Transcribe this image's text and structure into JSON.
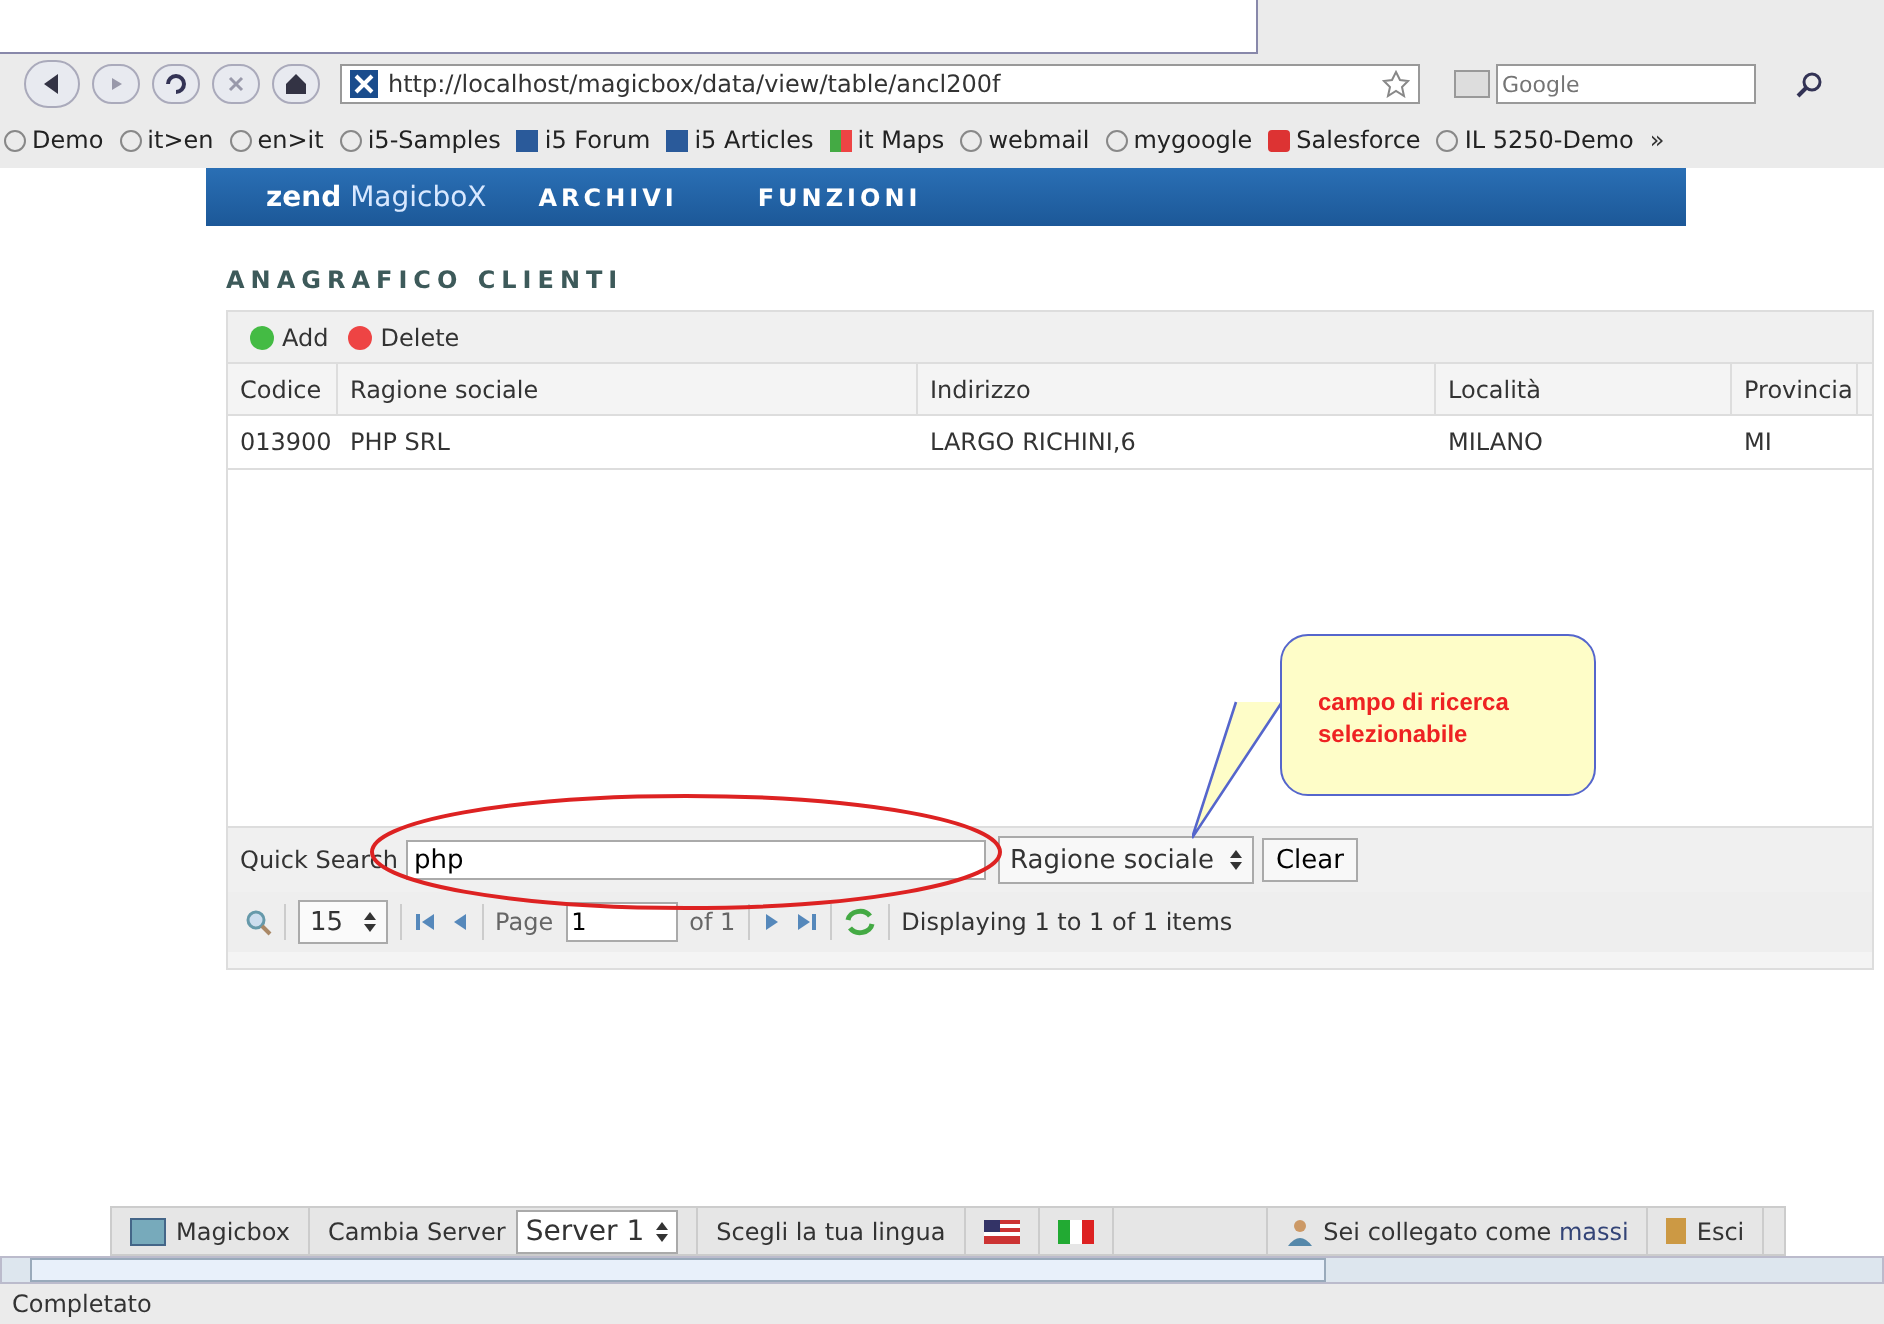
{
  "browser": {
    "url": "http://localhost/magicbox/data/view/table/ancl200f",
    "search_placeholder": "Google",
    "bookmarks": [
      {
        "label": "Demo",
        "kind": "globe"
      },
      {
        "label": "it>en",
        "kind": "globe"
      },
      {
        "label": "en>it",
        "kind": "globe"
      },
      {
        "label": "i5-Samples",
        "kind": "globe"
      },
      {
        "label": "i5 Forum",
        "kind": "zend"
      },
      {
        "label": "i5 Articles",
        "kind": "zend"
      },
      {
        "label": "it Maps",
        "kind": "maps"
      },
      {
        "label": "webmail",
        "kind": "globe"
      },
      {
        "label": "mygoogle",
        "kind": "globe"
      },
      {
        "label": "Salesforce",
        "kind": "sales"
      },
      {
        "label": "IL 5250-Demo",
        "kind": "globe"
      }
    ],
    "more": "»"
  },
  "app": {
    "logo_prefix": "zend",
    "logo_name": "MagicboX",
    "menu": [
      "ARCHIVI",
      "FUNZIONI"
    ]
  },
  "page_title": "ANAGRAFICO CLIENTI",
  "grid": {
    "toolbar": [
      {
        "label": "Add",
        "kind": "add"
      },
      {
        "label": "Delete",
        "kind": "delete"
      }
    ],
    "columns": [
      "Codice",
      "Ragione sociale",
      "Indirizzo",
      "Località",
      "Provincia"
    ],
    "rows": [
      [
        "013900",
        "PHP SRL",
        "LARGO RICHINI,6",
        "MILANO",
        "MI"
      ]
    ],
    "quick_search": {
      "label": "Quick Search",
      "value": "php",
      "field": "Ragione sociale",
      "clear": "Clear"
    },
    "pager": {
      "page_size": "15",
      "page_label": "Page",
      "page": "1",
      "of": "of 1",
      "info": "Displaying 1 to 1 of 1 items"
    }
  },
  "callout": "campo di ricerca selezionabile",
  "taskbar": {
    "app": "Magicbox",
    "server_label": "Cambia Server",
    "server": "Server 1",
    "language_label": "Scegli la tua lingua",
    "user_prefix": "Sei collegato come",
    "user": "massi",
    "exit": "Esci"
  },
  "status_bar": "Completato"
}
